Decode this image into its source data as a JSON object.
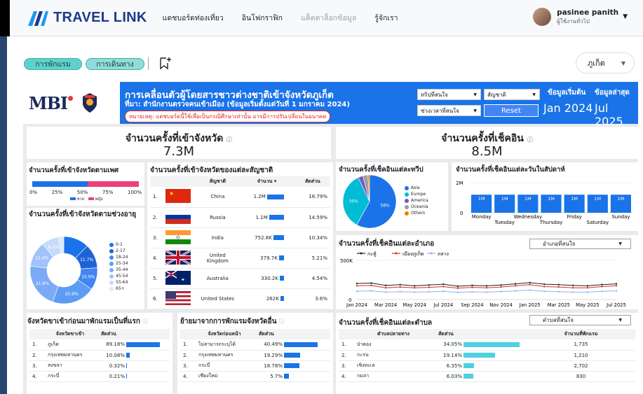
{
  "app": {
    "logo_text": "TRAVEL LINK",
    "nav": [
      "แดชบอร์ดท่องเที่ยว",
      "อินโฟกราฟิก",
      "แค็ตตาล็อกข้อมูล",
      "รู้จักเรา"
    ],
    "user_name": "pasinee panith",
    "user_role": "ผู้ใช้งานทั่วไป"
  },
  "filters": {
    "chip_1": "การพักแรม",
    "chip_2": "การเดินทาง",
    "province": "ภูเก็ต"
  },
  "banner": {
    "logo_text": "MBI",
    "title": "การเคลื่อนตัวผู้โดยสารชาวต่างชาติเข้าจังหวัดภูเก็ต",
    "source": "ที่มา: สำนักงานตรวจคนเข้าเมือง (ข้อมูลเริ่มตั้งแต่วันที่ 1 มกราคม 2024)",
    "note": "หมายเหตุ: แดชบอร์ดนี้ใช้เพื่อเป็นกรณีศึกษาเท่านั้น อาจมีการปรับเปลี่ยนในอนาคต",
    "f_trip": "ทริปที่สนใจ",
    "f_nat": "สัญชาติ",
    "f_time": "ช่วงเวลาที่สนใจ",
    "reset": "Reset",
    "start_label": "ข้อมูลเริ่มต้น",
    "start_value": "Jan 2024",
    "latest_label": "ข้อมูลล่าสุด",
    "latest_value": "Jul 2025"
  },
  "kpi": {
    "enter_title": "จำนวนครั้งที่เข้าจังหวัด",
    "enter_value": "7.3M",
    "checkin_title": "จำนวนครั้งที่เช็คอิน",
    "checkin_value": "8.5M"
  },
  "gender": {
    "title": "จำนวนครั้งที่เข้าจังหวัดตามเพศ",
    "ticks": [
      "0%",
      "25%",
      "50%",
      "75%",
      "100%"
    ],
    "legend": [
      "ชาย",
      "หญิง"
    ],
    "male_share": 0.52,
    "colors": [
      "#1a73e8",
      "#ec407a"
    ]
  },
  "age": {
    "title": "จำนวนครั้งที่เข้าจังหวัดตามช่วงอายุ",
    "segments": [
      {
        "label": "0-1",
        "value": 12.4,
        "show": "",
        "color": "#1a73e8"
      },
      {
        "label": "2-17",
        "value": 11.7,
        "show": "11.7%",
        "color": "#1e63d6"
      },
      {
        "label": "18-24",
        "value": 10.9,
        "show": "10.9%",
        "color": "#4285f4"
      },
      {
        "label": "25-34",
        "value": 20.9,
        "show": "20.9%",
        "color": "#5c9cf5"
      },
      {
        "label": "35-44",
        "value": 21.8,
        "show": "21.8%",
        "color": "#7baaf7"
      },
      {
        "label": "45-54",
        "value": 12.4,
        "show": "12.4%",
        "color": "#a1c2fa"
      },
      {
        "label": "55-64",
        "value": 8.2,
        "show": "8.2%",
        "color": "#c6dafc"
      },
      {
        "label": "65+",
        "value": 2.7,
        "show": "",
        "color": "#dce8fd"
      }
    ]
  },
  "nationality": {
    "title": "จำนวนครั้งที่เข้าจังหวัดของแต่ละสัญชาติ",
    "headers": [
      "สัญชาติ",
      "จำนวน ▾",
      "สัดส่วน"
    ],
    "rows": [
      {
        "rank": "1.",
        "name": "China",
        "count": "1.2M",
        "bar": 1.0,
        "share": "16.79%"
      },
      {
        "rank": "2.",
        "name": "Russia",
        "count": "1.1M",
        "bar": 0.87,
        "share": "14.59%"
      },
      {
        "rank": "3.",
        "name": "India",
        "count": "752.8K",
        "bar": 0.62,
        "share": "10.34%"
      },
      {
        "rank": "4.",
        "name": "United Kingdom",
        "count": "379.7K",
        "bar": 0.31,
        "share": "5.21%"
      },
      {
        "rank": "5.",
        "name": "Australia",
        "count": "330.2K",
        "bar": 0.27,
        "share": "4.54%"
      },
      {
        "rank": "6.",
        "name": "United States",
        "count": "262K",
        "bar": 0.21,
        "share": "3.6%"
      }
    ]
  },
  "continent": {
    "title": "จำนวนครั้งที่เช็คอินแต่ละทวีป",
    "segments": [
      {
        "label": "Asia",
        "value": 58,
        "show": "58%",
        "color": "#1a73e8"
      },
      {
        "label": "Europe",
        "value": 35,
        "show": "35%",
        "color": "#00bcd4"
      },
      {
        "label": "America",
        "value": 3,
        "show": "",
        "color": "#7e57c2"
      },
      {
        "label": "Oceania",
        "value": 3,
        "show": "",
        "color": "#9e9e9e"
      },
      {
        "label": "Others",
        "value": 1,
        "show": "",
        "color": "#f57c00"
      }
    ]
  },
  "weekday": {
    "title": "จำนวนครั้งที่เช็คอินแต่ละวันในสัปดาห์",
    "ytick_top": "2M",
    "ytick_zero": "0",
    "days": [
      "Monday",
      "Tuesday",
      "Wednesday",
      "Thursday",
      "Friday",
      "Saturday",
      "Sunday"
    ],
    "values": [
      1.2,
      1.2,
      1.2,
      1.2,
      1.2,
      1.2,
      1.2
    ],
    "labels": [
      "1M",
      "1M",
      "1M",
      "1M",
      "1M",
      "1M",
      "1M"
    ]
  },
  "district_line": {
    "title": "จำนวนครั้งที่เช็คอินแต่ละอำเภอ",
    "dropdown": "อำเภอที่สนใจ",
    "legend": [
      "กะทู้",
      "เมืองภูเก็ต",
      "ถลาง"
    ],
    "ylabels": [
      "500K",
      "0"
    ],
    "xlabels": [
      "Jan 2024",
      "Mar 2024",
      "May 2024",
      "Jul 2024",
      "Sep 2024",
      "Nov 2024",
      "Jan 2025",
      "Mar 2025",
      "May 2025",
      "Jul 2025"
    ],
    "series": [
      {
        "name": "กะทู้",
        "color": "#202124",
        "values": [
          205,
          210,
          180,
          190,
          175,
          185,
          195,
          170,
          180,
          175,
          185,
          200,
          215,
          195,
          190,
          180,
          175,
          190,
          200
        ]
      },
      {
        "name": "เมืองภูเก็ต",
        "color": "#d93025",
        "values": [
          175,
          180,
          150,
          160,
          150,
          155,
          165,
          145,
          155,
          150,
          160,
          175,
          190,
          165,
          160,
          150,
          150,
          165,
          175
        ]
      },
      {
        "name": "ถลาง",
        "color": "#8ab4f8",
        "values": [
          105,
          110,
          95,
          100,
          95,
          98,
          105,
          92,
          98,
          95,
          102,
          110,
          120,
          105,
          100,
          95,
          95,
          105,
          110
        ]
      }
    ],
    "chart_data": {
      "type": "line",
      "ylim": [
        0,
        500
      ]
    }
  },
  "first_province": {
    "title": "จังหวัดขาเข้าก่อนมาพักแรมเป็นที่แรก",
    "headers": [
      "จังหวัดขาเข้า",
      "สัดส่วน"
    ],
    "rows": [
      {
        "rank": "1.",
        "name": "ภูเก็ต",
        "share": "89.18%",
        "bar": 1.0
      },
      {
        "rank": "2.",
        "name": "กรุงเทพมหานคร",
        "share": "10.08%",
        "bar": 0.11
      },
      {
        "rank": "3.",
        "name": "สงขลา",
        "share": "0.32%",
        "bar": 0.01
      },
      {
        "rank": "4.",
        "name": "กระบี่",
        "share": "0.21%",
        "bar": 0.01
      }
    ]
  },
  "moved_from": {
    "title": "ย้ายมาจากการพักแรมจังหวัดอื่น",
    "headers": [
      "จังหวัดก่อนหน้า",
      "สัดส่วน"
    ],
    "rows": [
      {
        "rank": "1.",
        "name": "ไม่สามารถระบุได้",
        "share": "40.49%",
        "bar": 1.0
      },
      {
        "rank": "2.",
        "name": "กรุงเทพมหานคร",
        "share": "19.29%",
        "bar": 0.48
      },
      {
        "rank": "3.",
        "name": "กระบี่",
        "share": "18.78%",
        "bar": 0.46
      },
      {
        "rank": "4.",
        "name": "เชียงใหม่",
        "share": "5.7%",
        "bar": 0.14
      }
    ]
  },
  "subdistrict": {
    "title": "จำนวนครั้งที่เช็คอินแต่ละตำบล",
    "dropdown": "ตำบลที่สนใจ",
    "headers": [
      "ตำบลปลายทาง",
      "สัดส่วน",
      "จำนวนที่พักแรม"
    ],
    "rows": [
      {
        "rank": "1.",
        "name": "ป่าตอง",
        "share": "34.05%",
        "bar": 1.0,
        "count": "1,735"
      },
      {
        "rank": "2.",
        "name": "กะรน",
        "share": "19.14%",
        "bar": 0.56,
        "count": "1,210"
      },
      {
        "rank": "3.",
        "name": "เชิงทะเล",
        "share": "6.35%",
        "bar": 0.19,
        "count": "2,702"
      },
      {
        "rank": "4.",
        "name": "กมลา",
        "share": "6.03%",
        "bar": 0.18,
        "count": "830"
      }
    ]
  }
}
